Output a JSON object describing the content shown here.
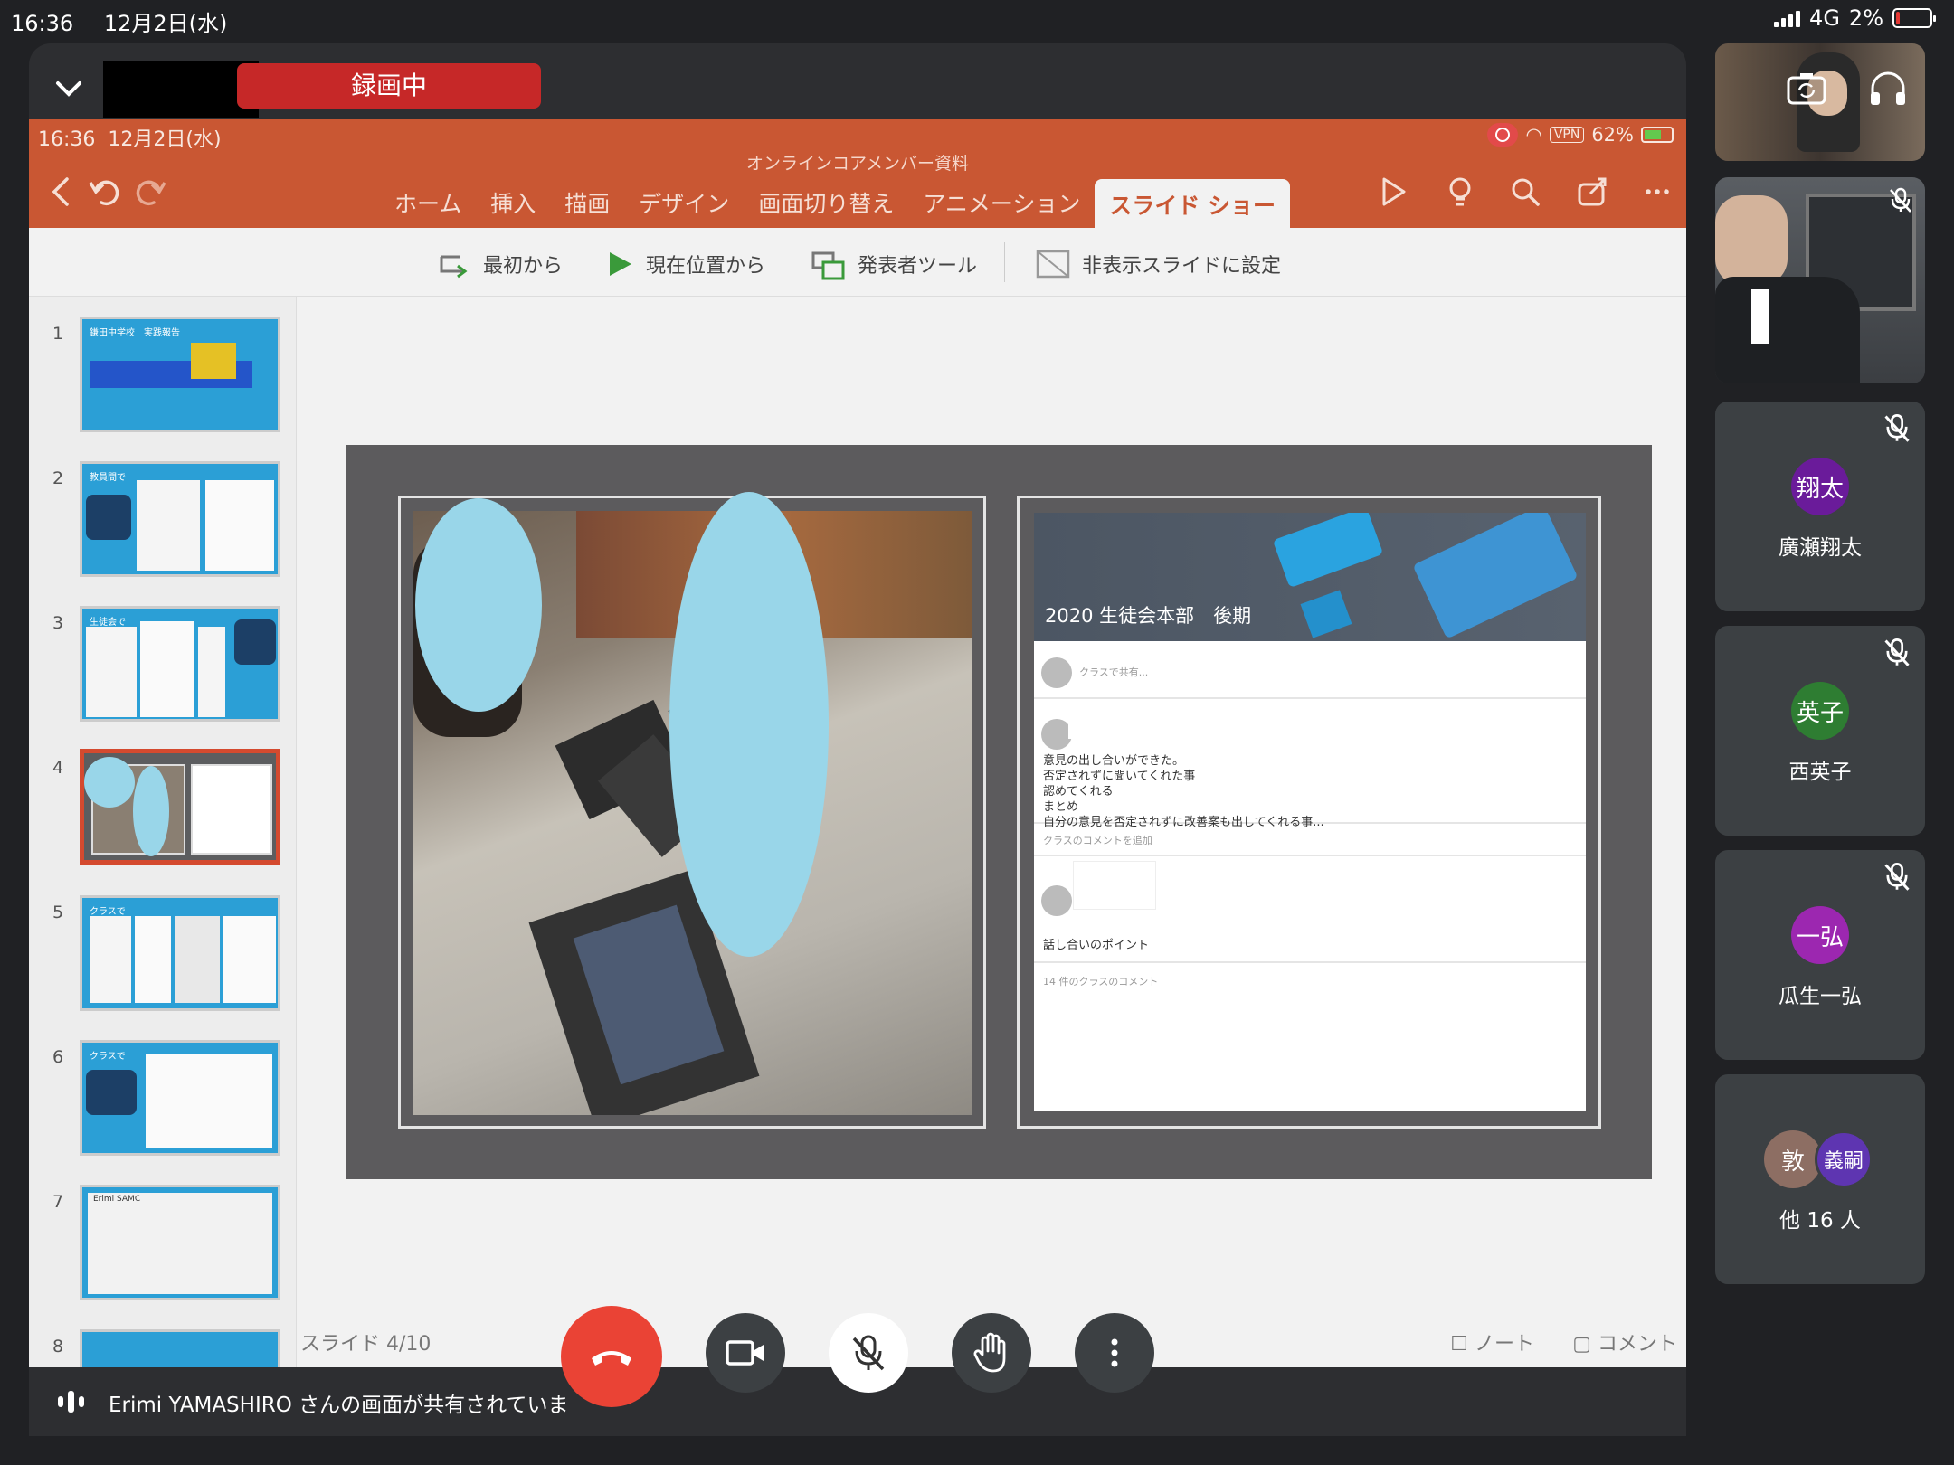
{
  "status_bar": {
    "time": "16:36",
    "date": "12月2日(水)",
    "network": "4G",
    "battery": "2%"
  },
  "meeting": {
    "recording_label": "録画中",
    "presenter_bar": "Erimi YAMASHIRO さんの画面が共有されていま"
  },
  "ppt": {
    "status_time": "16:36",
    "status_date": "12月2日(水)",
    "vpn": "VPN",
    "battery": "62%",
    "doc_title": "オンラインコアメンバー資料",
    "tabs": [
      "ホーム",
      "挿入",
      "描画",
      "デザイン",
      "画面切り替え",
      "アニメーション",
      "スライド ショー"
    ],
    "active_tab": "スライド ショー",
    "ribbon": {
      "from_start": "最初から",
      "from_current": "現在位置から",
      "presenter_tools": "発表者ツール",
      "hide_slide": "非表示スライドに設定"
    },
    "slide_numbers": [
      "1",
      "2",
      "3",
      "4",
      "5",
      "6",
      "7",
      "8"
    ],
    "slide_status": "スライド 4/10",
    "note": "ノート",
    "comment": "コメント",
    "thumb_titles": [
      "鎌田中学校　実践報告",
      "教員間で",
      "生徒会で",
      "",
      "クラスで",
      "クラスで",
      "Erimi SAMC"
    ],
    "slide": {
      "classroom_title": "2020 生徒会本部　後期",
      "share_placeholder": "クラスで共有...",
      "post_lines": [
        "意見の出し合いができた。",
        "否定されずに聞いてくれた事",
        "認めてくれる",
        "まとめ",
        "自分の意見を否定されずに改善案も出してくれる事..."
      ],
      "add_comment": "クラスのコメントを追加",
      "post2_text": "話し合いのポイント",
      "comment_count": "14 件のクラスのコメント"
    }
  },
  "participants": [
    {
      "name": "廣瀬翔太",
      "initials": "翔太",
      "color": "#6a1b9a"
    },
    {
      "name": "西英子",
      "initials": "英子",
      "color": "#2e7d32"
    },
    {
      "name": "瓜生一弘",
      "initials": "一弘",
      "color": "#9c27b0"
    }
  ],
  "others": {
    "avatar1": "敦",
    "avatar1_color": "#8d6e63",
    "avatar2": "義嗣",
    "avatar2_color": "#5e35b1",
    "label": "他 16 人"
  }
}
